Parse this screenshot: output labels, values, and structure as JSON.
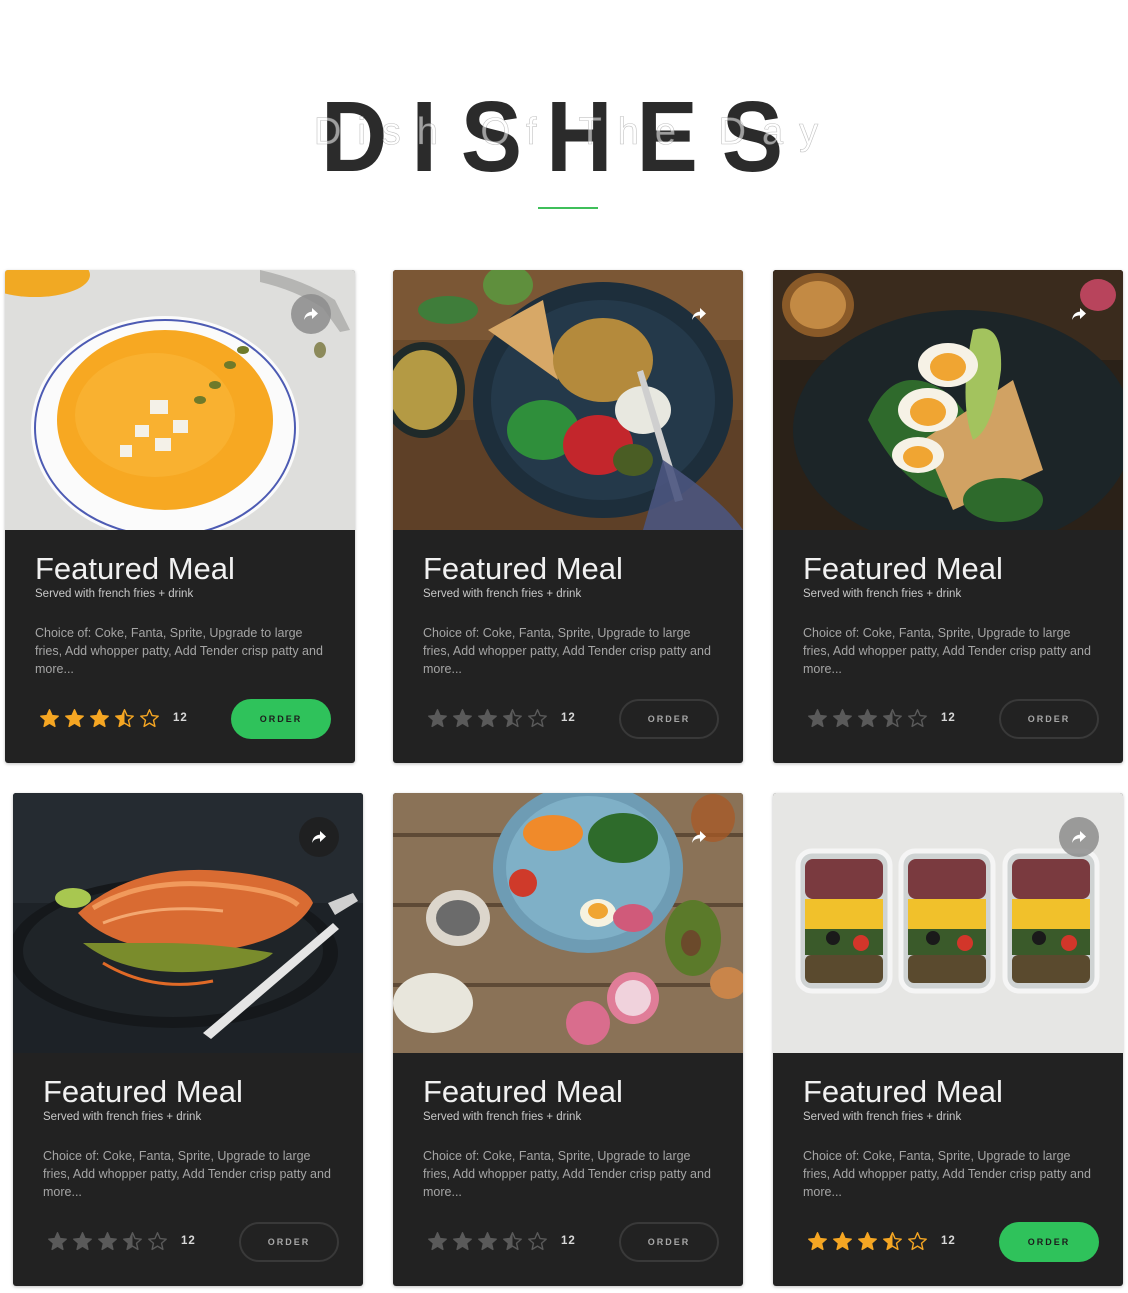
{
  "header": {
    "title": "DISHES",
    "subtitle": "Dish Of The Day",
    "accent_color": "#3fbf5a"
  },
  "cards": [
    {
      "title": "Featured Meal",
      "subtitle": "Served with french fries + drink",
      "description": "Choice of: Coke, Fanta, Sprite, Upgrade to large fries, Add whopper patty, Add Tender crisp patty and more...",
      "rating": 3.5,
      "rating_count": "12",
      "order_label": "ORDER",
      "active": true,
      "image": "pumpkin-soup",
      "share_icon": "share-icon"
    },
    {
      "title": "Featured Meal",
      "subtitle": "Served with french fries + drink",
      "description": "Choice of: Coke, Fanta, Sprite, Upgrade to large fries, Add whopper patty, Add Tender crisp patty and more...",
      "rating": 3.5,
      "rating_count": "12",
      "order_label": "ORDER",
      "active": false,
      "image": "chickpea-salad-bowl",
      "share_icon": "share-icon"
    },
    {
      "title": "Featured Meal",
      "subtitle": "Served with french fries + drink",
      "description": "Choice of: Coke, Fanta, Sprite, Upgrade to large fries, Add whopper patty, Add Tender crisp patty and more...",
      "rating": 3.5,
      "rating_count": "12",
      "order_label": "ORDER",
      "active": false,
      "image": "egg-avocado-toast",
      "share_icon": "share-icon"
    },
    {
      "title": "Featured Meal",
      "subtitle": "Served with french fries + drink",
      "description": "Choice of: Coke, Fanta, Sprite, Upgrade to large fries, Add whopper patty, Add Tender crisp patty and more...",
      "rating": 3.5,
      "rating_count": "12",
      "order_label": "ORDER",
      "active": false,
      "image": "salmon-plate",
      "share_icon": "share-icon"
    },
    {
      "title": "Featured Meal",
      "subtitle": "Served with french fries + drink",
      "description": "Choice of: Coke, Fanta, Sprite, Upgrade to large fries, Add whopper patty, Add Tender crisp patty and more...",
      "rating": 3.5,
      "rating_count": "12",
      "order_label": "ORDER",
      "active": false,
      "image": "egg-vegetable-plate",
      "share_icon": "share-icon"
    },
    {
      "title": "Featured Meal",
      "subtitle": "Served with french fries + drink",
      "description": "Choice of: Coke, Fanta, Sprite, Upgrade to large fries, Add whopper patty, Add Tender crisp patty and more...",
      "rating": 3.5,
      "rating_count": "12",
      "order_label": "ORDER",
      "active": true,
      "image": "meal-prep-containers",
      "share_icon": "share-icon"
    }
  ],
  "colors": {
    "card_bg": "#222222",
    "star_active": "#f5a623",
    "star_inactive": "#5a5a5a",
    "order_active": "#2fc25b"
  }
}
